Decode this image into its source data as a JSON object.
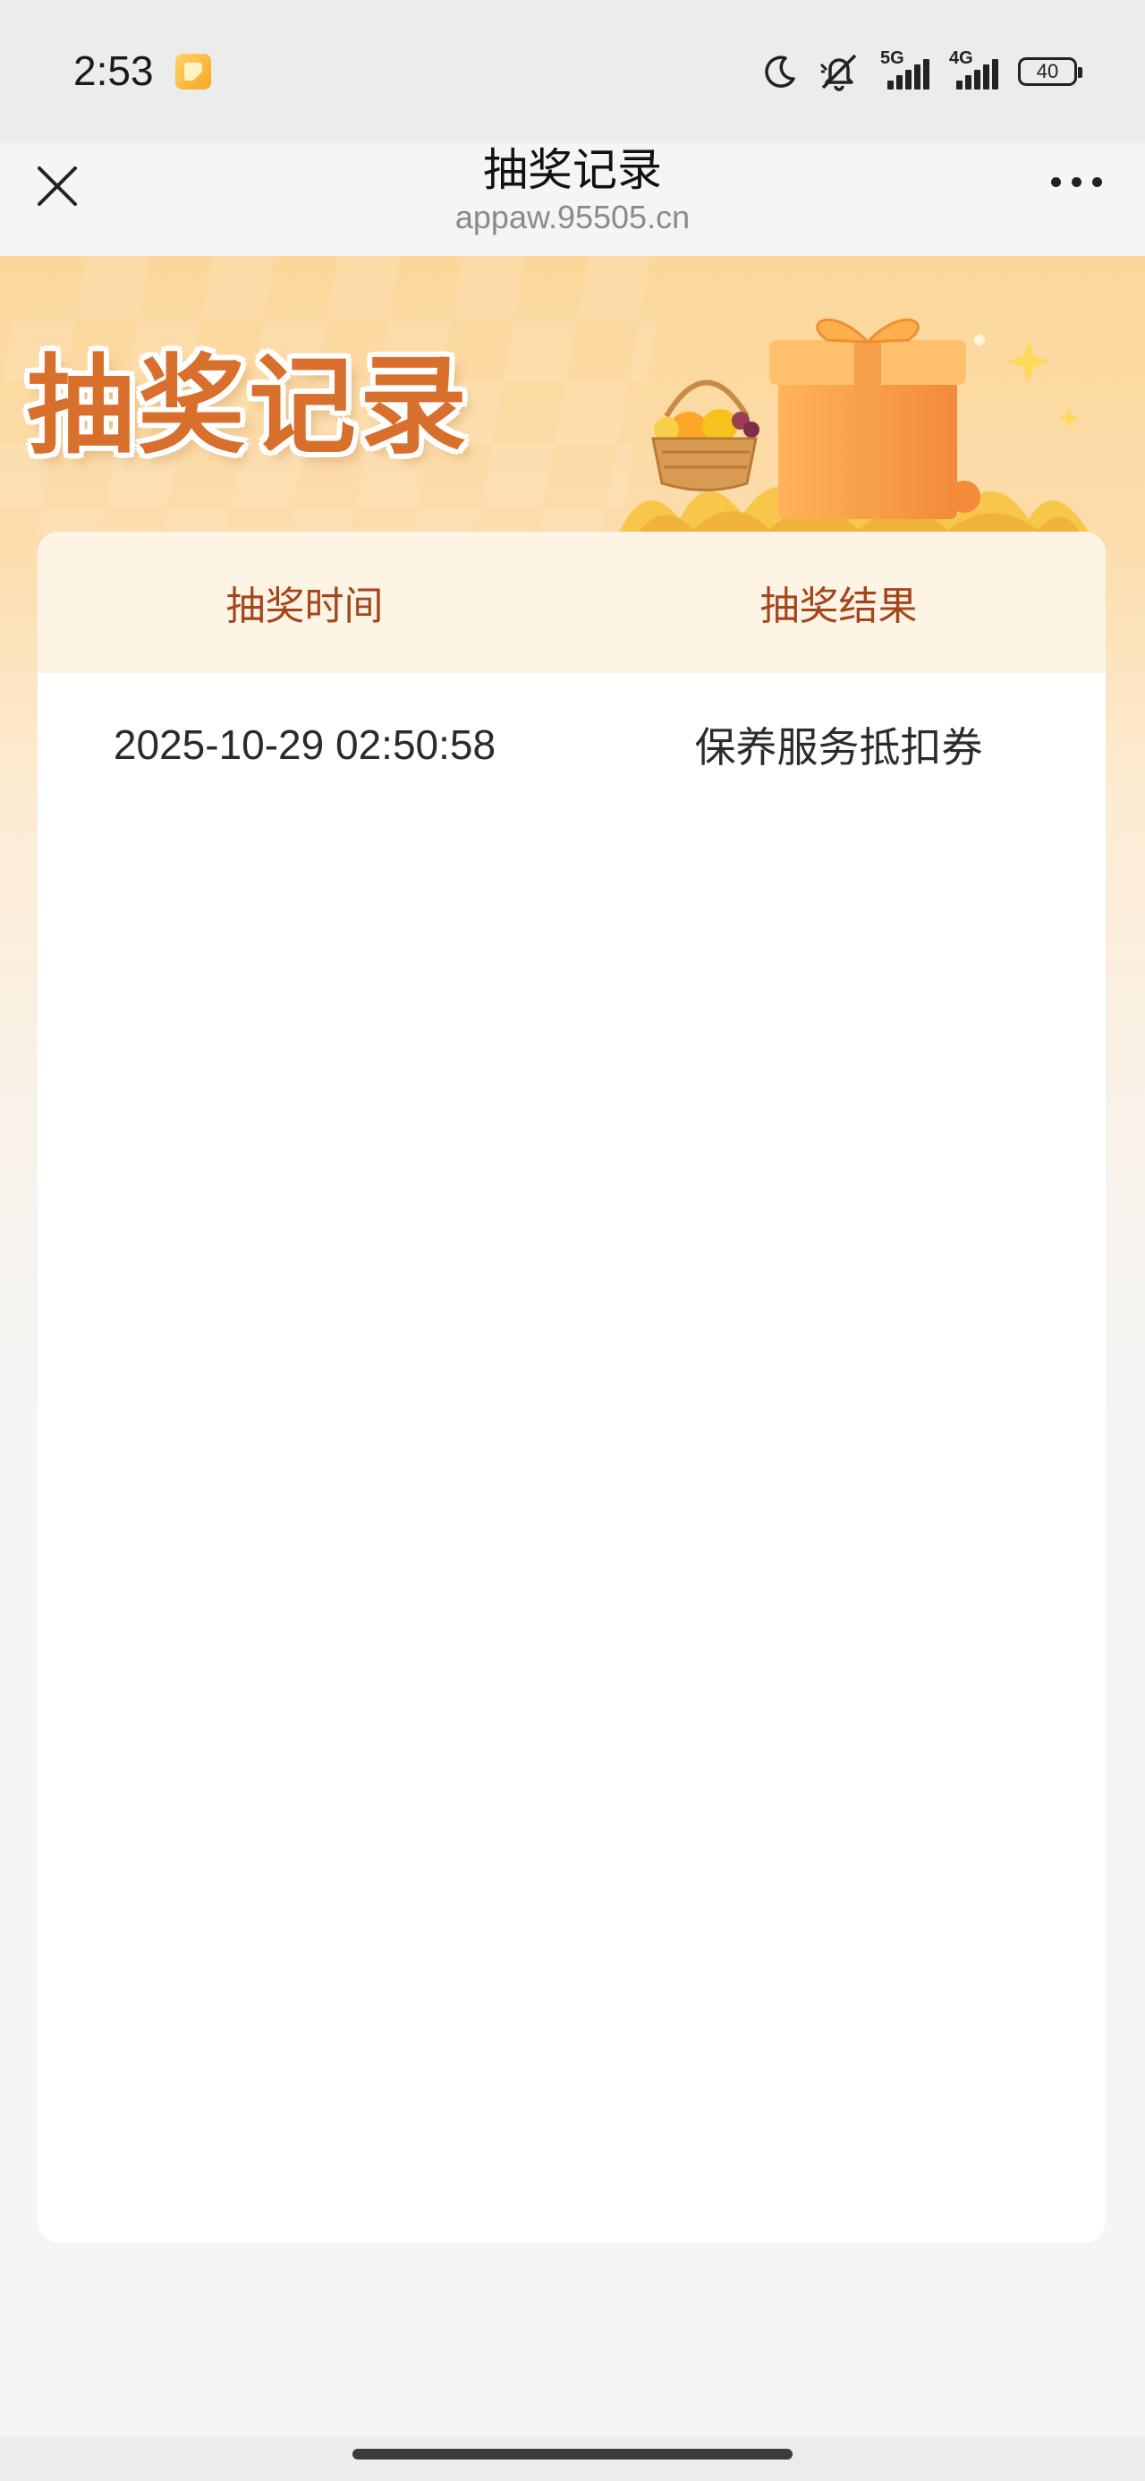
{
  "status_bar": {
    "time": "2:53",
    "network_1": "5G",
    "network_2": "4G",
    "battery": "40"
  },
  "nav": {
    "title": "抽奖记录",
    "url": "appaw.95505.cn"
  },
  "banner": {
    "title": "抽奖记录"
  },
  "table": {
    "headers": [
      "抽奖时间",
      "抽奖结果"
    ],
    "rows": [
      {
        "time": "2025-10-29 02:50:58",
        "result": "保养服务抵扣券"
      }
    ]
  },
  "colors": {
    "header_text": "#a3461b",
    "banner_title": "#d86f2c",
    "table_head_bg": "#fdf4e6"
  }
}
